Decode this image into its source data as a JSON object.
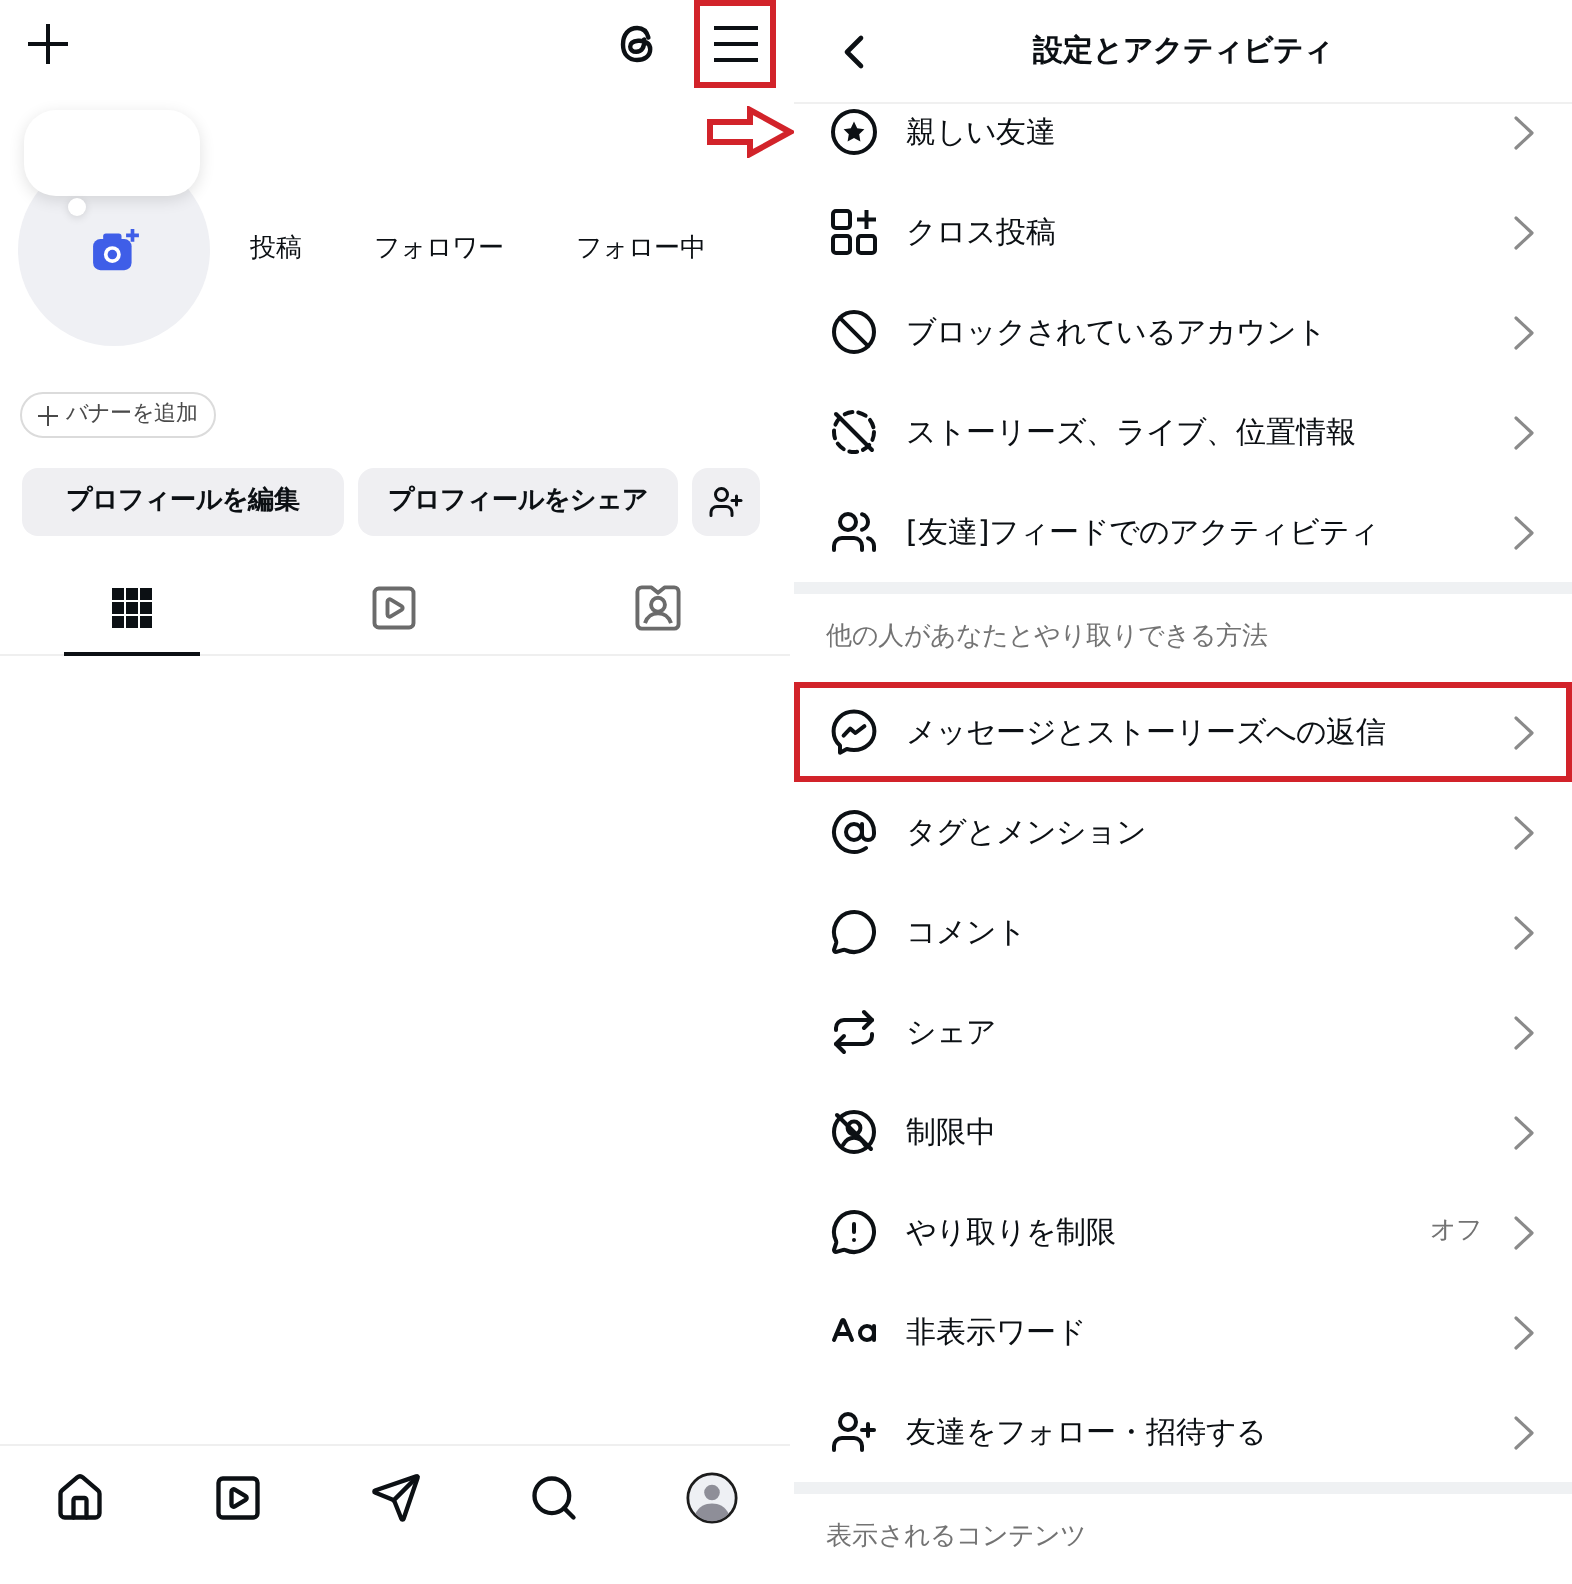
{
  "left_panel": {
    "top_bar": {
      "menu_button": {
        "highlighted": true
      }
    },
    "profile": {
      "stats": [
        "投稿",
        "フォロワー",
        "フォロー中"
      ],
      "banner_button": "バナーを追加",
      "buttons": [
        "プロフィールを編集",
        "プロフィールをシェア"
      ]
    },
    "profile_tabs": [
      {
        "kind": "grid",
        "selected": true
      },
      {
        "kind": "reels",
        "selected": false
      },
      {
        "kind": "tagged",
        "selected": false
      }
    ],
    "bottom_nav": [
      {
        "kind": "home"
      },
      {
        "kind": "reels"
      },
      {
        "kind": "messages"
      },
      {
        "kind": "search"
      },
      {
        "kind": "profile"
      }
    ]
  },
  "right_panel": {
    "header": {
      "title": "設定とアクティビティ"
    },
    "sections": [
      {
        "rows": [
          {
            "kind": "close_friends",
            "label": "親しい友達",
            "highlighted": false,
            "pointed": true
          },
          {
            "kind": "cross_post",
            "label": "クロス投稿",
            "highlighted": false,
            "pointed": false
          },
          {
            "kind": "blocked",
            "label": "ブロックされているアカウント",
            "highlighted": false,
            "pointed": false
          },
          {
            "kind": "story_location",
            "label": "ストーリーズ、ライブ、位置情報",
            "highlighted": false,
            "pointed": false
          },
          {
            "kind": "friends_feed",
            "label": "[友達]フィードでのアクティビティ",
            "highlighted": false,
            "pointed": false
          }
        ]
      },
      {
        "heading": "他の人があなたとやり取りできる方法",
        "rows": [
          {
            "kind": "messages",
            "label": "メッセージとストーリーズへの返信",
            "highlighted": true,
            "pointed": false
          },
          {
            "kind": "tags",
            "label": "タグとメンション",
            "highlighted": false,
            "pointed": false
          },
          {
            "kind": "comments",
            "label": "コメント",
            "highlighted": false,
            "pointed": false
          },
          {
            "kind": "sharing",
            "label": "シェア",
            "highlighted": false,
            "pointed": false
          },
          {
            "kind": "restricted",
            "label": "制限中",
            "highlighted": false,
            "pointed": false
          },
          {
            "kind": "limit",
            "label": "やり取りを制限",
            "value": "オフ",
            "highlighted": false,
            "pointed": false
          },
          {
            "kind": "hidden_words",
            "label": "非表示ワード",
            "highlighted": false,
            "pointed": false
          },
          {
            "kind": "invite",
            "label": "友達をフォロー・招待する",
            "highlighted": false,
            "pointed": false
          }
        ]
      },
      {
        "heading": "表示されるコンテンツ"
      }
    ]
  }
}
